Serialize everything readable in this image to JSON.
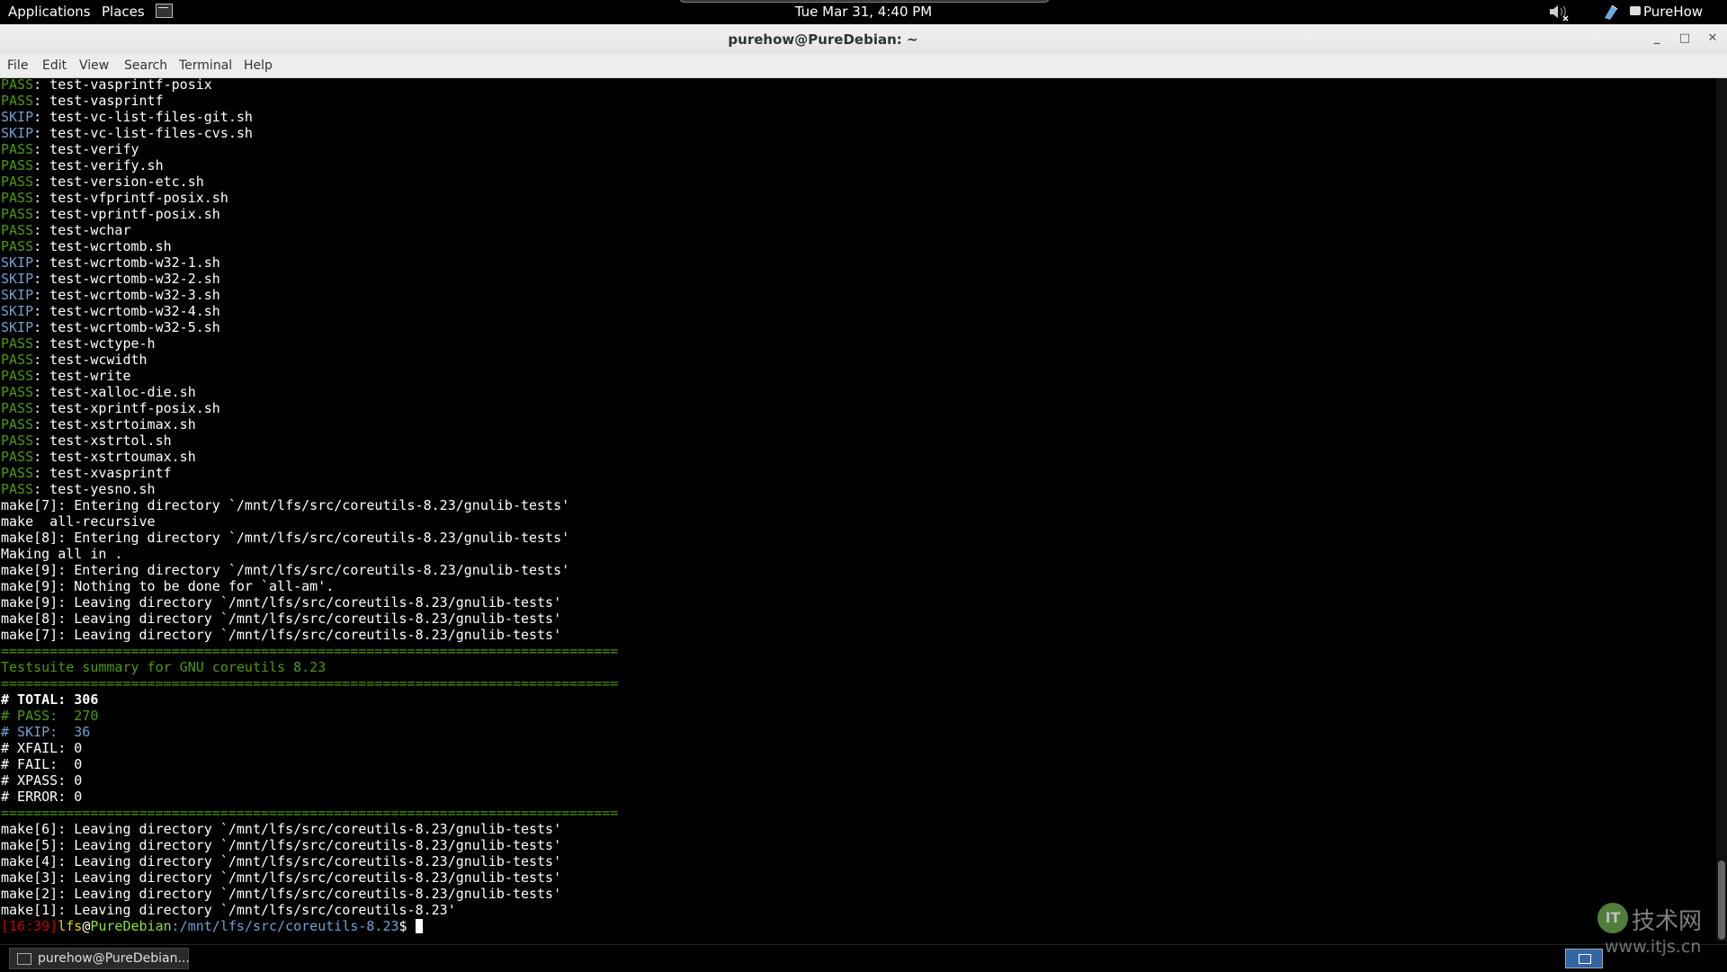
{
  "top_panel": {
    "applications": "Applications",
    "places": "Places",
    "clock": "Tue Mar 31,  4:40 PM",
    "user": "PureHow",
    "volume_icon": "speaker-muted-icon",
    "network_icon": "network-icon"
  },
  "window": {
    "title": "purehow@PureDebian: ~",
    "minimize": "_",
    "maximize": "□",
    "close": "✕"
  },
  "menubar": {
    "items": [
      "File",
      "Edit",
      "View",
      "Search",
      "Terminal",
      "Help"
    ]
  },
  "terminal": {
    "lines": [
      [
        {
          "t": "PASS",
          "c": "c-pass"
        },
        {
          "t": ": test-vasprintf-posix"
        }
      ],
      [
        {
          "t": "PASS",
          "c": "c-pass"
        },
        {
          "t": ": test-vasprintf"
        }
      ],
      [
        {
          "t": "SKIP",
          "c": "c-skip"
        },
        {
          "t": ": test-vc-list-files-git.sh"
        }
      ],
      [
        {
          "t": "SKIP",
          "c": "c-skip"
        },
        {
          "t": ": test-vc-list-files-cvs.sh"
        }
      ],
      [
        {
          "t": "PASS",
          "c": "c-pass"
        },
        {
          "t": ": test-verify"
        }
      ],
      [
        {
          "t": "PASS",
          "c": "c-pass"
        },
        {
          "t": ": test-verify.sh"
        }
      ],
      [
        {
          "t": "PASS",
          "c": "c-pass"
        },
        {
          "t": ": test-version-etc.sh"
        }
      ],
      [
        {
          "t": "PASS",
          "c": "c-pass"
        },
        {
          "t": ": test-vfprintf-posix.sh"
        }
      ],
      [
        {
          "t": "PASS",
          "c": "c-pass"
        },
        {
          "t": ": test-vprintf-posix.sh"
        }
      ],
      [
        {
          "t": "PASS",
          "c": "c-pass"
        },
        {
          "t": ": test-wchar"
        }
      ],
      [
        {
          "t": "PASS",
          "c": "c-pass"
        },
        {
          "t": ": test-wcrtomb.sh"
        }
      ],
      [
        {
          "t": "SKIP",
          "c": "c-skip"
        },
        {
          "t": ": test-wcrtomb-w32-1.sh"
        }
      ],
      [
        {
          "t": "SKIP",
          "c": "c-skip"
        },
        {
          "t": ": test-wcrtomb-w32-2.sh"
        }
      ],
      [
        {
          "t": "SKIP",
          "c": "c-skip"
        },
        {
          "t": ": test-wcrtomb-w32-3.sh"
        }
      ],
      [
        {
          "t": "SKIP",
          "c": "c-skip"
        },
        {
          "t": ": test-wcrtomb-w32-4.sh"
        }
      ],
      [
        {
          "t": "SKIP",
          "c": "c-skip"
        },
        {
          "t": ": test-wcrtomb-w32-5.sh"
        }
      ],
      [
        {
          "t": "PASS",
          "c": "c-pass"
        },
        {
          "t": ": test-wctype-h"
        }
      ],
      [
        {
          "t": "PASS",
          "c": "c-pass"
        },
        {
          "t": ": test-wcwidth"
        }
      ],
      [
        {
          "t": "PASS",
          "c": "c-pass"
        },
        {
          "t": ": test-write"
        }
      ],
      [
        {
          "t": "PASS",
          "c": "c-pass"
        },
        {
          "t": ": test-xalloc-die.sh"
        }
      ],
      [
        {
          "t": "PASS",
          "c": "c-pass"
        },
        {
          "t": ": test-xprintf-posix.sh"
        }
      ],
      [
        {
          "t": "PASS",
          "c": "c-pass"
        },
        {
          "t": ": test-xstrtoimax.sh"
        }
      ],
      [
        {
          "t": "PASS",
          "c": "c-pass"
        },
        {
          "t": ": test-xstrtol.sh"
        }
      ],
      [
        {
          "t": "PASS",
          "c": "c-pass"
        },
        {
          "t": ": test-xstrtoumax.sh"
        }
      ],
      [
        {
          "t": "PASS",
          "c": "c-pass"
        },
        {
          "t": ": test-xvasprintf"
        }
      ],
      [
        {
          "t": "PASS",
          "c": "c-pass"
        },
        {
          "t": ": test-yesno.sh"
        }
      ],
      [
        {
          "t": "make[7]: Entering directory `/mnt/lfs/src/coreutils-8.23/gnulib-tests'"
        }
      ],
      [
        {
          "t": "make  all-recursive"
        }
      ],
      [
        {
          "t": "make[8]: Entering directory `/mnt/lfs/src/coreutils-8.23/gnulib-tests'"
        }
      ],
      [
        {
          "t": "Making all in ."
        }
      ],
      [
        {
          "t": "make[9]: Entering directory `/mnt/lfs/src/coreutils-8.23/gnulib-tests'"
        }
      ],
      [
        {
          "t": "make[9]: Nothing to be done for `all-am'."
        }
      ],
      [
        {
          "t": "make[9]: Leaving directory `/mnt/lfs/src/coreutils-8.23/gnulib-tests'"
        }
      ],
      [
        {
          "t": "make[8]: Leaving directory `/mnt/lfs/src/coreutils-8.23/gnulib-tests'"
        }
      ],
      [
        {
          "t": "make[7]: Leaving directory `/mnt/lfs/src/coreutils-8.23/gnulib-tests'"
        }
      ],
      [
        {
          "t": "============================================================================",
          "c": "c-green"
        }
      ],
      [
        {
          "t": "Testsuite summary for GNU coreutils 8.23",
          "c": "c-green"
        }
      ],
      [
        {
          "t": "============================================================================",
          "c": "c-green"
        }
      ],
      [
        {
          "t": "# TOTAL: 306",
          "c": "c-bold"
        }
      ],
      [
        {
          "t": "# PASS:  270",
          "c": "c-green"
        }
      ],
      [
        {
          "t": "# SKIP:  36",
          "c": "c-blue"
        }
      ],
      [
        {
          "t": "# XFAIL: 0"
        }
      ],
      [
        {
          "t": "# FAIL:  0"
        }
      ],
      [
        {
          "t": "# XPASS: 0"
        }
      ],
      [
        {
          "t": "# ERROR: 0"
        }
      ],
      [
        {
          "t": "============================================================================",
          "c": "c-green"
        }
      ],
      [
        {
          "t": "make[6]: Leaving directory `/mnt/lfs/src/coreutils-8.23/gnulib-tests'"
        }
      ],
      [
        {
          "t": "make[5]: Leaving directory `/mnt/lfs/src/coreutils-8.23/gnulib-tests'"
        }
      ],
      [
        {
          "t": "make[4]: Leaving directory `/mnt/lfs/src/coreutils-8.23/gnulib-tests'"
        }
      ],
      [
        {
          "t": "make[3]: Leaving directory `/mnt/lfs/src/coreutils-8.23/gnulib-tests'"
        }
      ],
      [
        {
          "t": "make[2]: Leaving directory `/mnt/lfs/src/coreutils-8.23/gnulib-tests'"
        }
      ],
      [
        {
          "t": "make[1]: Leaving directory `/mnt/lfs/src/coreutils-8.23'"
        }
      ]
    ],
    "prompt": {
      "time": "[16:39]",
      "user": "lfs",
      "at": "@",
      "host": "PureDebian",
      "path": ":/mnt/lfs/src/coreutils-8.23",
      "symbol": "$ "
    }
  },
  "taskbar": {
    "task_label": "purehow@PureDebian..."
  },
  "watermark": {
    "logo_text": "IT",
    "cn_text": "技术网",
    "url": "www.itjs.cn"
  },
  "colors": {
    "pass": "#4e9a06",
    "skip": "#729fcf",
    "prompt_time": "#cc0000",
    "prompt_user": "#edd400",
    "prompt_host": "#8ae234",
    "terminal_bg": "#000000"
  }
}
